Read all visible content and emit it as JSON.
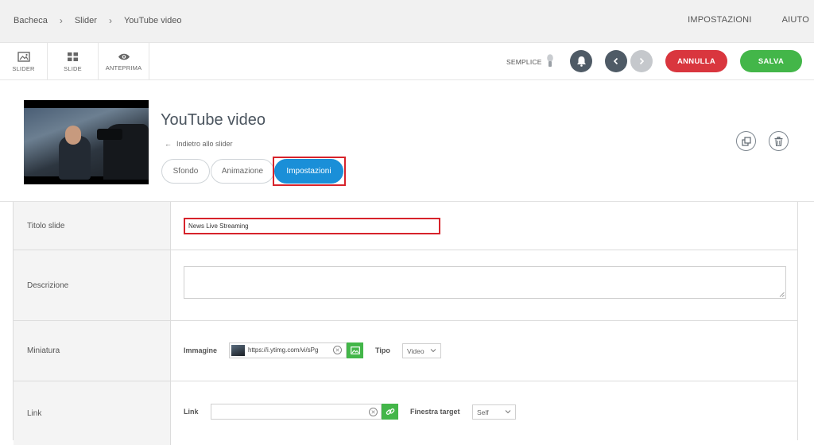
{
  "breadcrumb": [
    "Bacheca",
    "Slider",
    "YouTube video"
  ],
  "topnav": {
    "settings": "IMPOSTAZIONI",
    "help": "AIUTO"
  },
  "toolbar": {
    "slider_label": "SLIDER",
    "slide_label": "SLIDE",
    "preview_label": "ANTEPRIMA",
    "mode_label": "SEMPLICE",
    "cancel_label": "ANNULLA",
    "save_label": "SALVA"
  },
  "slide": {
    "title": "YouTube video",
    "back_label": "Indietro allo slider",
    "tabs": [
      {
        "label": "Sfondo",
        "active": false
      },
      {
        "label": "Animazione",
        "active": false
      },
      {
        "label": "Impostazioni",
        "active": true
      }
    ]
  },
  "form": {
    "title_label": "Titolo slide",
    "title_value": "News Live Streaming",
    "description_label": "Descrizione",
    "description_value": "",
    "thumbnail_label": "Miniatura",
    "image_label": "Immagine",
    "image_url": "https://i.ytimg.com/vi/sPg",
    "type_label": "Tipo",
    "type_value": "Video",
    "link_section_label": "Link",
    "link_label": "Link",
    "link_value": "",
    "target_label": "Finestra target",
    "target_value": "Self"
  },
  "colors": {
    "accent_blue": "#1a8fd8",
    "cancel_red": "#d9363e",
    "save_green": "#43b649",
    "dark_button": "#4f5b66",
    "highlight_red": "#d7232b"
  }
}
